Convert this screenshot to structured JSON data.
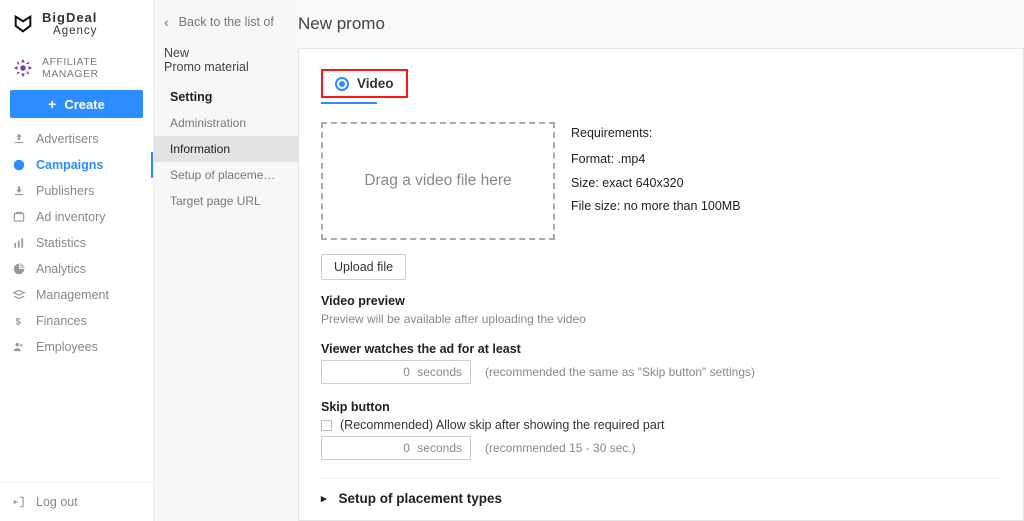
{
  "brand": {
    "line1": "BigDeal",
    "line2": "Agency"
  },
  "role": "AFFILIATE MANAGER",
  "create_label": "Create",
  "nav": [
    {
      "key": "advertisers",
      "label": "Advertisers"
    },
    {
      "key": "campaigns",
      "label": "Campaigns"
    },
    {
      "key": "publishers",
      "label": "Publishers"
    },
    {
      "key": "ad-inventory",
      "label": "Ad inventory"
    },
    {
      "key": "statistics",
      "label": "Statistics"
    },
    {
      "key": "analytics",
      "label": "Analytics"
    },
    {
      "key": "management",
      "label": "Management"
    },
    {
      "key": "finances",
      "label": "Finances"
    },
    {
      "key": "employees",
      "label": "Employees"
    }
  ],
  "logout": "Log out",
  "panel2": {
    "back": "Back to the list of",
    "h1": "New",
    "h2": "Promo material",
    "section": "Setting",
    "items": [
      {
        "label": "Administration"
      },
      {
        "label": "Information"
      },
      {
        "label": "Setup of placement t..."
      },
      {
        "label": "Target page URL"
      }
    ]
  },
  "main": {
    "title": "New promo",
    "tab": "Video",
    "dropzone": "Drag a video file here",
    "requirements": {
      "head": "Requirements:",
      "lines": [
        "Format: .mp4",
        "Size: exact 640x320",
        "File size: no more than 100MB"
      ]
    },
    "upload": "Upload file",
    "preview": {
      "label": "Video preview",
      "hint": "Preview will be available after uploading the video"
    },
    "watch": {
      "label": "Viewer watches the ad for at least",
      "value": "0",
      "unit": "seconds",
      "hint": "(recommended the same as \"Skip button\" settings)"
    },
    "skip": {
      "label": "Skip button",
      "check": "(Recommended) Allow skip after showing the required part",
      "value": "0",
      "unit": "seconds",
      "hint": "(recommended 15 - 30 sec.)"
    },
    "accordion": "Setup of placement types"
  }
}
